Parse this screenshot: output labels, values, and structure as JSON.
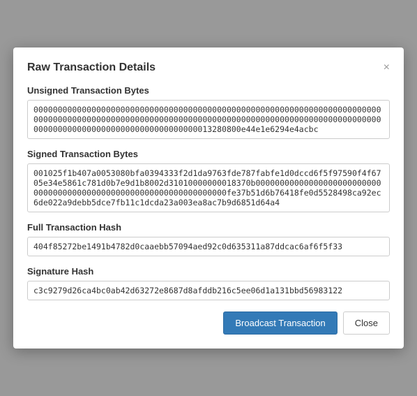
{
  "modal": {
    "title": "Raw Transaction Details",
    "close_label": "×"
  },
  "sections": {
    "unsigned_label": "Unsigned Transaction Bytes",
    "unsigned_value": "0000000000000000000000000000000000000000000000000000000000000000000000000000000000000000000000000000000000000000000000000000000000000000000000000000000000000000000000000000000000013280800e44e1e6294e4acbc",
    "signed_label": "Signed Transaction Bytes",
    "signed_value": "001025f1b407a0053080bfa0394333f2d1da9763fde787fabfe1d0dccd6f5f97590f4f6705e34e5861c781d0b7e9d1b8002d31010000000018370b000000000000000000000000000000000000000000000000000000000000000000fe37b51d6b76418fe0d5528498ca92ec6de022a9debb5dce7fb11c1dcda23a003ea8ac7b9d6851d64a4",
    "full_hash_label": "Full Transaction Hash",
    "full_hash_value": "404f85272be1491b4782d0caaebb57094aed92c0d635311a87ddcac6af6f5f33",
    "sig_hash_label": "Signature Hash",
    "sig_hash_value": "c3c9279d26ca4bc0ab42d63272e8687d8afddb216c5ee06d1a131bbd56983122"
  },
  "footer": {
    "broadcast_label": "Broadcast Transaction",
    "close_label": "Close"
  }
}
